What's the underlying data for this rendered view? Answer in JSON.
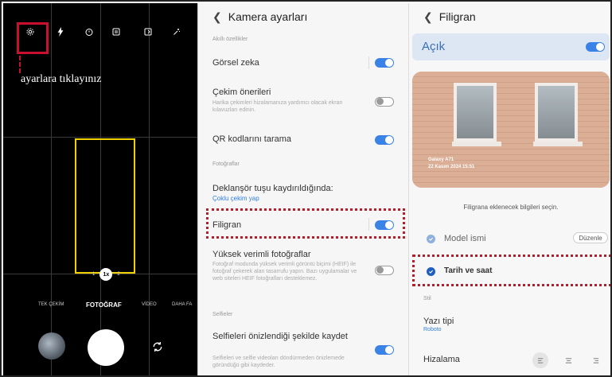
{
  "camera": {
    "hint": "ayarlara tıklayınız",
    "zoom": {
      "left": "1",
      "active": "1x",
      "right": "2"
    },
    "modes": [
      "TEK ÇEKİM",
      "FOTOĞRAF",
      "VİDEO",
      "DAHA FA"
    ],
    "top_icons": [
      "gear-icon",
      "flash-icon",
      "timer-icon",
      "aspect-ratio-icon",
      "motion-photo-icon",
      "filter-icon"
    ],
    "colors": {
      "highlight": "#c8102e",
      "focus": "#f2d100"
    }
  },
  "settings": {
    "title": "Kamera ayarları",
    "sections": {
      "smart": "Akıllı özellikler",
      "photos": "Fotoğraflar",
      "selfies": "Selfieler"
    },
    "items": {
      "gorsel_zeka": {
        "title": "Görsel zeka",
        "on": true
      },
      "cekim_onerileri": {
        "title": "Çekim önerileri",
        "sub": "Harika çekimleri hizalamanıza yardımcı olacak ekran kılavuzları edinin.",
        "on": false
      },
      "qr": {
        "title": "QR kodlarını tarama",
        "on": true
      },
      "deklansor": {
        "title": "Deklanşör tuşu kaydırıldığında:",
        "link": "Çoklu çekim yap"
      },
      "filigran": {
        "title": "Filigran",
        "on": true
      },
      "yuksek": {
        "title": "Yüksek verimli fotoğraflar",
        "sub": "Fotoğraf modunda yüksek verimli görüntü biçimi (HEIF) ile fotoğraf çekerek alan tasarrufu yapın. Bazı uygulamalar ve web siteleri HEIF fotoğrafları desteklemez.",
        "on": false
      },
      "selfie": {
        "title": "Selfieleri önizlendiği şekilde kaydet",
        "sub": "Selfieleri ve selfie videoları döndürmeden önizlemede göründüğü gibi kaydeder.",
        "on": true
      }
    },
    "colors": {
      "accent": "#3a82e6",
      "highlight": "#b21e2a"
    }
  },
  "watermark": {
    "title": "Filigran",
    "acik": "Açık",
    "acik_on": true,
    "photo_line1": "Galaxy A71",
    "photo_line2": "22 Kasım 2024 15:51",
    "info": "Filigrana eklenecek bilgileri seçin.",
    "model": "Model ismi",
    "edit": "Düzenle",
    "date": "Tarih ve saat",
    "style_section": "Stil",
    "font_label": "Yazı tipi",
    "font_value": "Roboto",
    "align_label": "Hizalama",
    "align_options": [
      "align-left-icon",
      "align-center-icon",
      "align-right-icon"
    ]
  }
}
